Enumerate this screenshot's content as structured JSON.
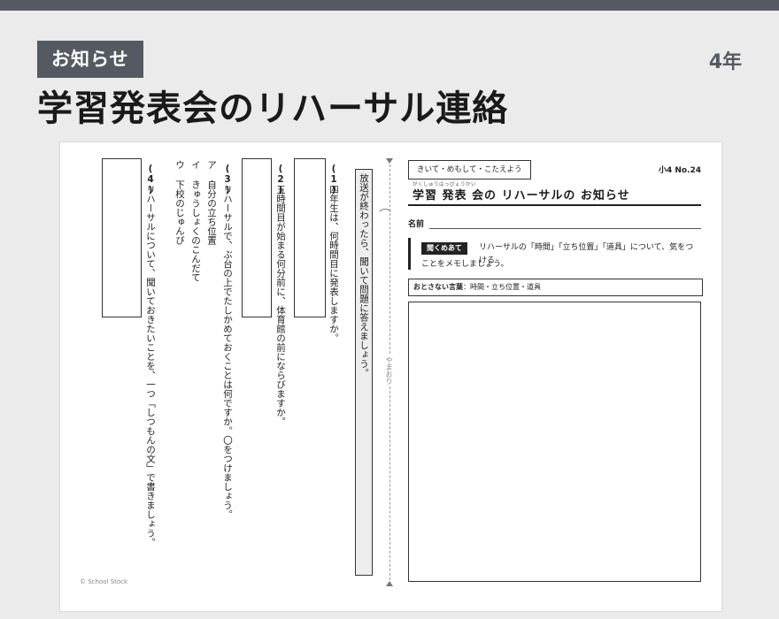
{
  "header": {
    "badge": "お知らせ",
    "grade": "4年",
    "headline": "学習発表会のリハーサル連絡"
  },
  "worksheet": {
    "intro": "放送が終わったら、聞いて問題に答えましょう。",
    "q1_num": "(1)",
    "q1": "四年生は、何時間目に発表しますか。",
    "q2_num": "(2)",
    "q2": "五時間目が始まる何分前に、体育館の前にならびますか。",
    "q3_num": "(3)",
    "q3": "リハーサルで、ぶ台の上でたしかめておくことは何ですか。〇をつけましょう。",
    "q3_a": "ア 自分の立ち位置",
    "q3_i": "イ きゅうしょくのこんだて",
    "q3_u": "ウ 下校のじゅんび",
    "q4_num": "(4)",
    "q4": "リハーサルについて、聞いておきたいことを、一つ「しつもんの文」で書きましょう。",
    "fold_label": "やまおり",
    "category": "きいて・めもして・こたえよう",
    "number": "小4 No.24",
    "title_furigana": "がくしゅうはっぴょうかい",
    "title": "学習 発表 会の リハーサルの お知らせ",
    "name_label": "名前",
    "instruction_tag": "聞くめあて",
    "instruction_line1": "リハーサルの「時間」「立ち位置」「道具」について、気をつける",
    "instruction_line2": "ことをメモしましょう。",
    "keywords_label": "おとさない言葉",
    "keywords": "：時間・立ち位置・道具",
    "copyright": "© School Stock"
  }
}
